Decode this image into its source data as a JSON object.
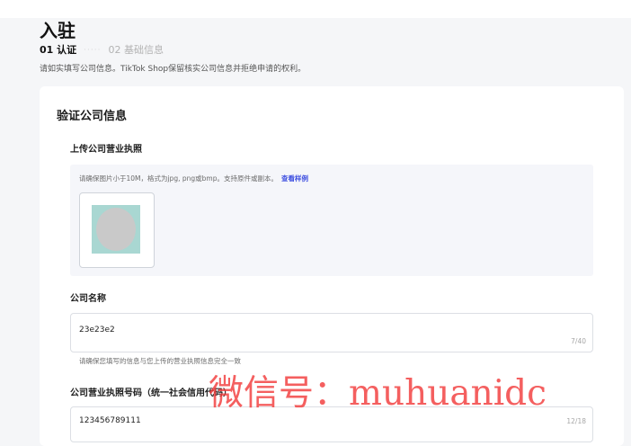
{
  "page": {
    "title": "入驻",
    "steps": [
      {
        "label": "01 认证",
        "active": true
      },
      {
        "label": "02 基础信息",
        "active": false
      }
    ],
    "step_separator": "·····",
    "instruction": "请如实填写公司信息。TikTok Shop保留核实公司信息并拒绝申请的权利。"
  },
  "form": {
    "section_title": "验证公司信息",
    "license_upload": {
      "label": "上传公司营业执照",
      "hint": "请确保图片小于10M，格式为jpg, png或bmp。支持原件或副本。",
      "example_link": "查看样例"
    },
    "company_name": {
      "label": "公司名称",
      "value": "23e23e2",
      "counter": "7/40",
      "help": "请确保您填写的信息与您上传的营业执照信息完全一致"
    },
    "license_number": {
      "label": "公司营业执照号码（统一社会信用代码）",
      "value": "123456789111",
      "counter": "12/18"
    }
  },
  "watermark": {
    "text": "微信号：muhuanidc"
  },
  "colors": {
    "link": "#3d4ee0",
    "watermark": "#f23c3c",
    "page_bg": "#f5f6f8",
    "upload_bg": "#f5f6fa"
  }
}
